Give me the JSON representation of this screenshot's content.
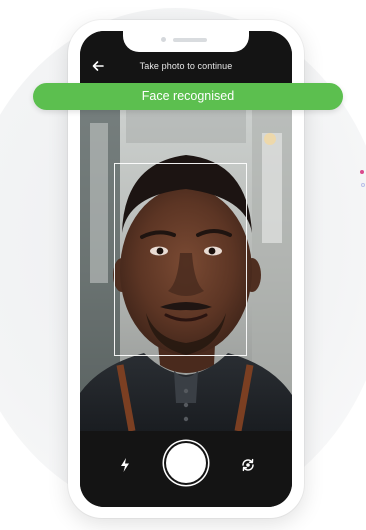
{
  "header": {
    "title": "Take photo to continue",
    "back_icon": "arrow-left-icon"
  },
  "status_banner": {
    "text": "Face recognised",
    "color": "#5cbf4f"
  },
  "camera_controls": {
    "flash_icon": "flash-icon",
    "shutter_icon": "shutter-button",
    "flip_icon": "flip-camera-icon"
  },
  "colors": {
    "bar_background": "#141414",
    "accent_pink": "#d94a8c",
    "accent_blue": "#b9c0e8"
  }
}
